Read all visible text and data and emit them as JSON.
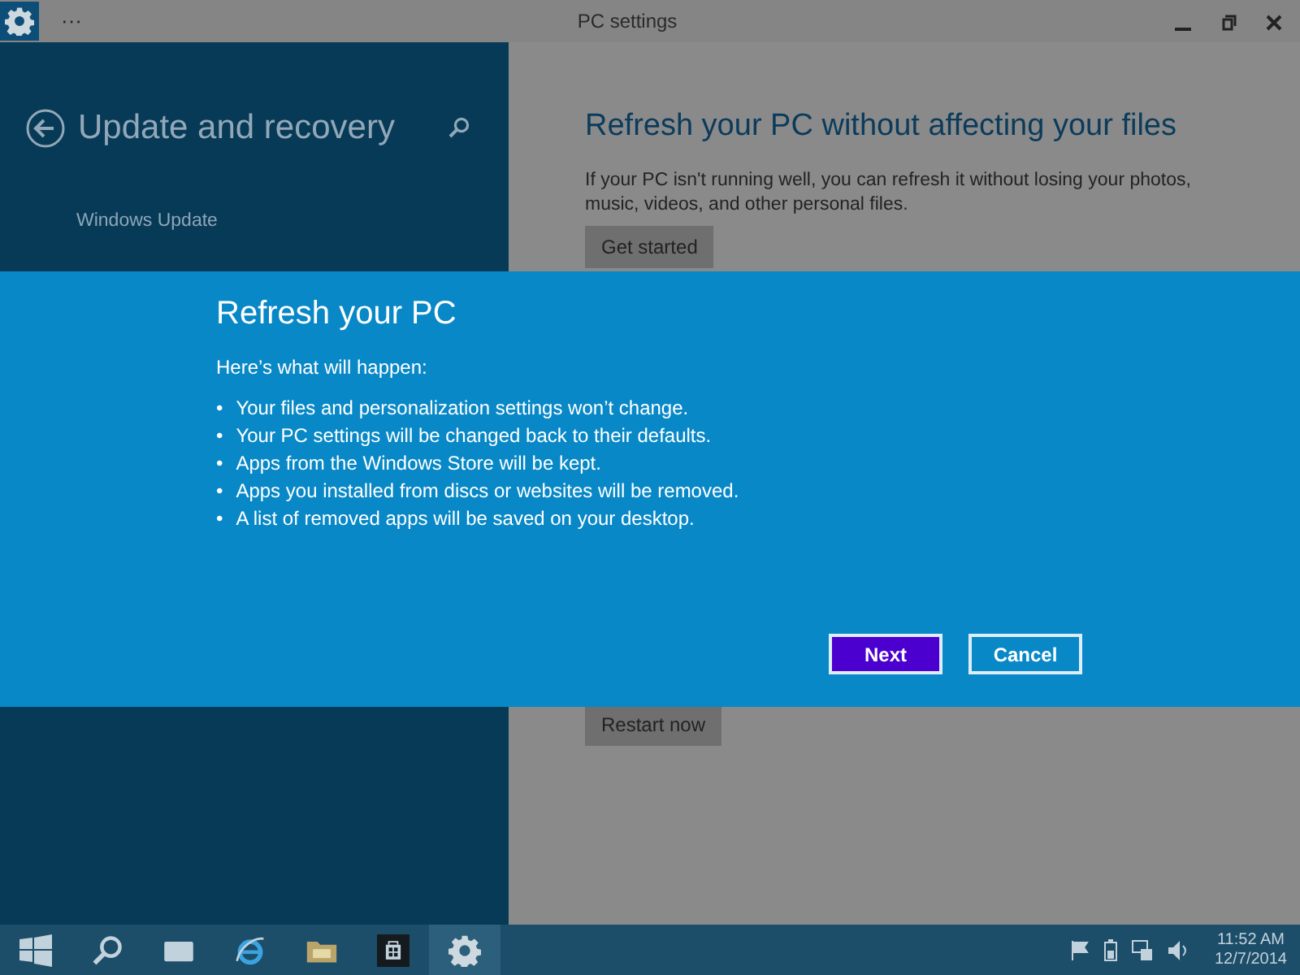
{
  "window": {
    "title": "PC settings",
    "menu": "···"
  },
  "sidebar": {
    "title": "Update and recovery",
    "items": [
      {
        "label": "Windows Update",
        "selected": false
      }
    ]
  },
  "content": {
    "heading": "Refresh your PC without affecting your files",
    "description": "If your PC isn't running well, you can refresh it without losing your photos, music, videos, and other personal files.",
    "buttons": [
      "Get started",
      "Restart now"
    ]
  },
  "dialog": {
    "title": "Refresh your PC",
    "intro": "Here’s what will happen:",
    "bullet": "•",
    "bullets": [
      "Your files and personalization settings won’t change.",
      "Your PC settings will be changed back to their defaults.",
      "Apps from the Windows Store will be kept.",
      "Apps you installed from discs or websites will be removed.",
      "A list of removed apps will be saved on your desktop."
    ],
    "buttons": [
      {
        "label": "Next",
        "selected": true
      },
      {
        "label": "Cancel",
        "selected": false
      }
    ]
  },
  "taskbar": {
    "apps": [
      {
        "kind": "start",
        "active": false
      },
      {
        "kind": "search",
        "active": false
      },
      {
        "kind": "taskview",
        "active": false
      },
      {
        "kind": "browser",
        "active": false
      },
      {
        "kind": "folder",
        "active": false
      },
      {
        "kind": "store",
        "active": false
      },
      {
        "kind": "settings",
        "active": true
      }
    ],
    "time": "11:52 AM",
    "date": "12/7/2014"
  }
}
